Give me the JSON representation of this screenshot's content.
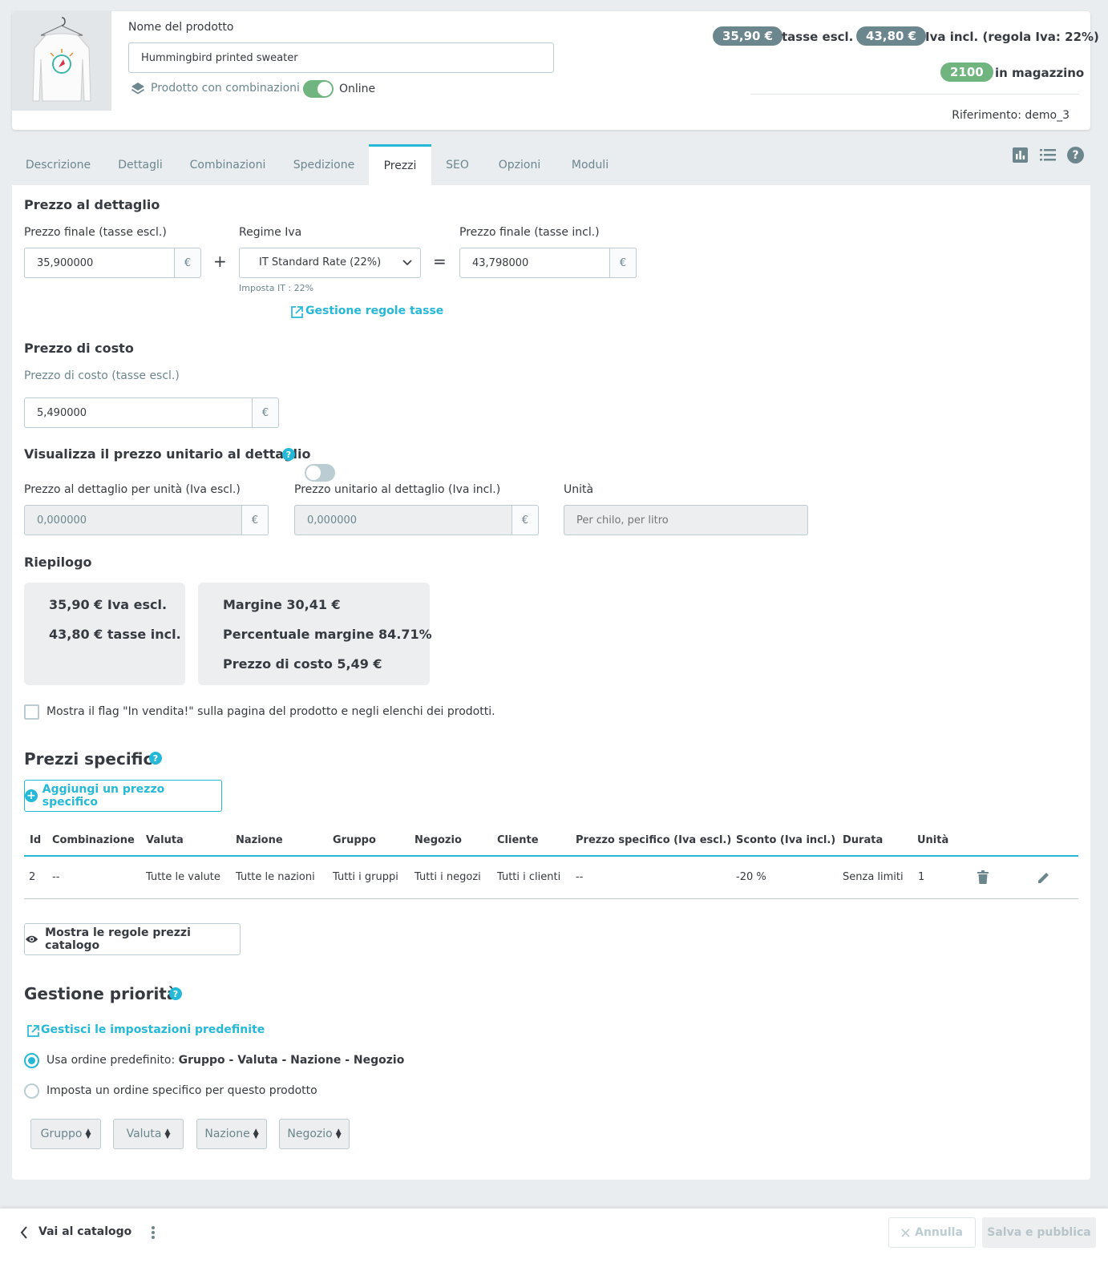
{
  "header": {
    "product_name_label": "Nome del prodotto",
    "product_name_value": "Hummingbird printed sweater",
    "combinations_label": "Prodotto con combinazioni",
    "online_label": "Online",
    "price_excl_badge": "35,90 €",
    "price_excl_text": "tasse escl.",
    "price_incl_badge": "43,80 €",
    "price_incl_text": "Iva incl. (regola Iva: 22%)",
    "stock_badge": "2100",
    "stock_text": "in magazzino",
    "reference": "Riferimento: demo_3",
    "colors": {
      "badge_grey": "#6c868e",
      "badge_green": "#70b580",
      "toggle_on": "#70b580"
    }
  },
  "tabs": [
    "Descrizione",
    "Dettagli",
    "Combinazioni",
    "Spedizione",
    "Prezzi",
    "SEO",
    "Opzioni",
    "Moduli"
  ],
  "active_tab": "Prezzi",
  "retail": {
    "title": "Prezzo al dettaglio",
    "price_excl_label": "Prezzo finale (tasse escl.)",
    "price_excl_value": "35,900000",
    "currency": "€",
    "plus": "+",
    "tax_rule_label": "Regime Iva",
    "tax_rule_value": "IT Standard Rate (22%)",
    "tax_hint": "Imposta IT : 22%",
    "equals": "=",
    "price_incl_label": "Prezzo finale (tasse incl.)",
    "price_incl_value": "43,798000",
    "tax_rules_link": "Gestione regole tasse"
  },
  "cost": {
    "title": "Prezzo di costo",
    "label": "Prezzo di costo (tasse escl.)",
    "value": "5,490000"
  },
  "unit_price": {
    "title": "Visualizza il prezzo unitario al dettaglio",
    "excl_label": "Prezzo al dettaglio per unità (Iva escl.)",
    "excl_value": "0,000000",
    "incl_label": "Prezzo unitario al dettaglio (Iva incl.)",
    "incl_value": "0,000000",
    "unit_label": "Unità",
    "unit_placeholder": "Per chilo, per litro"
  },
  "summary": {
    "title": "Riepilogo",
    "line_excl": "35,90 € Iva escl.",
    "line_incl": "43,80 € tasse incl.",
    "margin": "Margine 30,41 €",
    "margin_pct": "Percentuale margine 84.71%",
    "cost": "Prezzo di costo 5,49 €"
  },
  "on_sale_label": "Mostra il flag \"In vendita!\" sulla pagina del prodotto e negli elenchi dei prodotti.",
  "specific_prices": {
    "title": "Prezzi specifici",
    "add_button": "Aggiungi un prezzo specifico",
    "columns": [
      "Id",
      "Combinazione",
      "Valuta",
      "Nazione",
      "Gruppo",
      "Negozio",
      "Cliente",
      "Prezzo specifico (Iva escl.)",
      "Sconto (Iva incl.)",
      "Durata",
      "Unità"
    ],
    "rows": [
      [
        "2",
        "--",
        "Tutte le valute",
        "Tutte le nazioni",
        "Tutti i gruppi",
        "Tutti i negozi",
        "Tutti i clienti",
        "--",
        "-20 %",
        "Senza limiti",
        "1"
      ]
    ],
    "catalog_rules_button": "Mostra le regole prezzi catalogo"
  },
  "priority": {
    "title": "Gestione priorità",
    "defaults_link": "Gestisci le impostazioni predefinite",
    "default_order_prefix": "Usa ordine predefinito: ",
    "default_order_value": "Gruppo - Valuta - Nazione - Negozio",
    "specific_order_label": "Imposta un ordine specifico per questo prodotto",
    "selects": [
      "Gruppo",
      "Valuta",
      "Nazione",
      "Negozio"
    ]
  },
  "footer": {
    "back_label": "Vai al catalogo",
    "cancel_label": "Annulla",
    "save_label": "Salva e pubblica"
  },
  "accent_color": "#25b9d7"
}
